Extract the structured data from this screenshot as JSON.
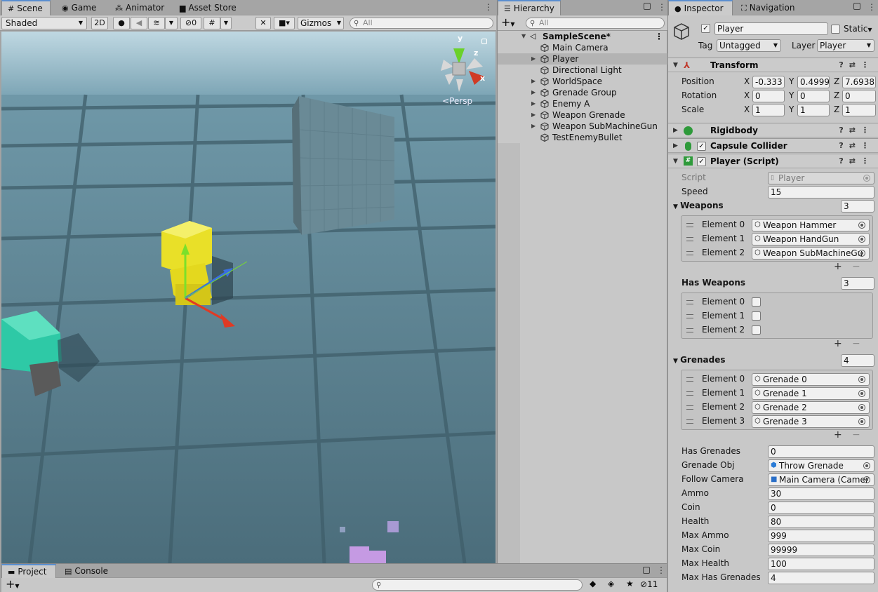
{
  "scene_tabs": [
    {
      "label": "Scene",
      "icon": "grid-icon",
      "active": true
    },
    {
      "label": "Game",
      "icon": "gamepad-icon",
      "active": false
    },
    {
      "label": "Animator",
      "icon": "animator-icon",
      "active": false
    },
    {
      "label": "Asset Store",
      "icon": "store-bag-icon",
      "active": false
    }
  ],
  "scene_toolbar": {
    "shading_mode": "Shaded",
    "mode_2d": "2D",
    "hidden_count": "0",
    "gizmos": "Gizmos",
    "search_placeholder": "All"
  },
  "scene_view": {
    "projection": "Persp",
    "axis_y": "y",
    "axis_z": "z",
    "axis_x": "x"
  },
  "hierarchy": {
    "title": "Hierarchy",
    "search_placeholder": "All",
    "scene_name": "SampleScene*",
    "items": [
      {
        "label": "Main Camera",
        "expandable": false,
        "selected": false
      },
      {
        "label": "Player",
        "expandable": true,
        "selected": true
      },
      {
        "label": "Directional Light",
        "expandable": false,
        "selected": false
      },
      {
        "label": "WorldSpace",
        "expandable": true,
        "selected": false
      },
      {
        "label": "Grenade Group",
        "expandable": true,
        "selected": false
      },
      {
        "label": "Enemy A",
        "expandable": true,
        "selected": false
      },
      {
        "label": "Weapon Grenade",
        "expandable": true,
        "selected": false
      },
      {
        "label": "Weapon SubMachineGun",
        "expandable": true,
        "selected": false
      },
      {
        "label": "TestEnemyBullet",
        "expandable": false,
        "selected": false
      }
    ]
  },
  "inspector": {
    "tabs": [
      {
        "label": "Inspector",
        "icon": "info-icon"
      },
      {
        "label": "Navigation",
        "icon": "navigation-icon"
      }
    ],
    "object_name": "Player",
    "static_label": "Static",
    "tag_label": "Tag",
    "tag_value": "Untagged",
    "layer_label": "Layer",
    "layer_value": "Player",
    "transform": {
      "title": "Transform",
      "position_label": "Position",
      "rotation_label": "Rotation",
      "scale_label": "Scale",
      "axis_x": "X",
      "axis_y": "Y",
      "axis_z": "Z",
      "position": [
        "-0.333",
        "0.4999",
        "7.69383"
      ],
      "rotation": [
        "0",
        "0",
        "0"
      ],
      "scale": [
        "1",
        "1",
        "1"
      ]
    },
    "components": [
      {
        "title": "Rigidbody",
        "has_checkbox": false
      },
      {
        "title": "Capsule Collider",
        "has_checkbox": true
      }
    ],
    "player_script": {
      "title": "Player (Script)",
      "script_label": "Script",
      "script_value": "Player",
      "speed_label": "Speed",
      "speed_value": "15",
      "weapons_label": "Weapons",
      "weapons_count": "3",
      "weapons": [
        {
          "label": "Element 0",
          "value": "Weapon Hammer"
        },
        {
          "label": "Element 1",
          "value": "Weapon HandGun"
        },
        {
          "label": "Element 2",
          "value": "Weapon SubMachineGu"
        }
      ],
      "has_weapons_label": "Has Weapons",
      "has_weapons_count": "3",
      "has_weapons": [
        {
          "label": "Element 0"
        },
        {
          "label": "Element 1"
        },
        {
          "label": "Element 2"
        }
      ],
      "grenades_label": "Grenades",
      "grenades_count": "4",
      "grenades": [
        {
          "label": "Element 0",
          "value": "Grenade 0"
        },
        {
          "label": "Element 1",
          "value": "Grenade 1"
        },
        {
          "label": "Element 2",
          "value": "Grenade 2"
        },
        {
          "label": "Element 3",
          "value": "Grenade 3"
        }
      ],
      "fields": [
        {
          "label": "Has Grenades",
          "value": "0"
        },
        {
          "label": "Grenade Obj",
          "value": "Throw Grenade",
          "object": true
        },
        {
          "label": "Follow Camera",
          "value": "Main Camera (Camer",
          "object": true
        },
        {
          "label": "Ammo",
          "value": "30"
        },
        {
          "label": "Coin",
          "value": "0"
        },
        {
          "label": "Health",
          "value": "80"
        },
        {
          "label": "Max Ammo",
          "value": "999"
        },
        {
          "label": "Max Coin",
          "value": "99999"
        },
        {
          "label": "Max Health",
          "value": "100"
        },
        {
          "label": "Max Has Grenades",
          "value": "4"
        }
      ]
    }
  },
  "bottom_tabs": [
    {
      "label": "Project",
      "icon": "folder-icon"
    },
    {
      "label": "Console",
      "icon": "console-icon"
    }
  ],
  "bottom_toolbar": {
    "hidden_count": "11"
  }
}
